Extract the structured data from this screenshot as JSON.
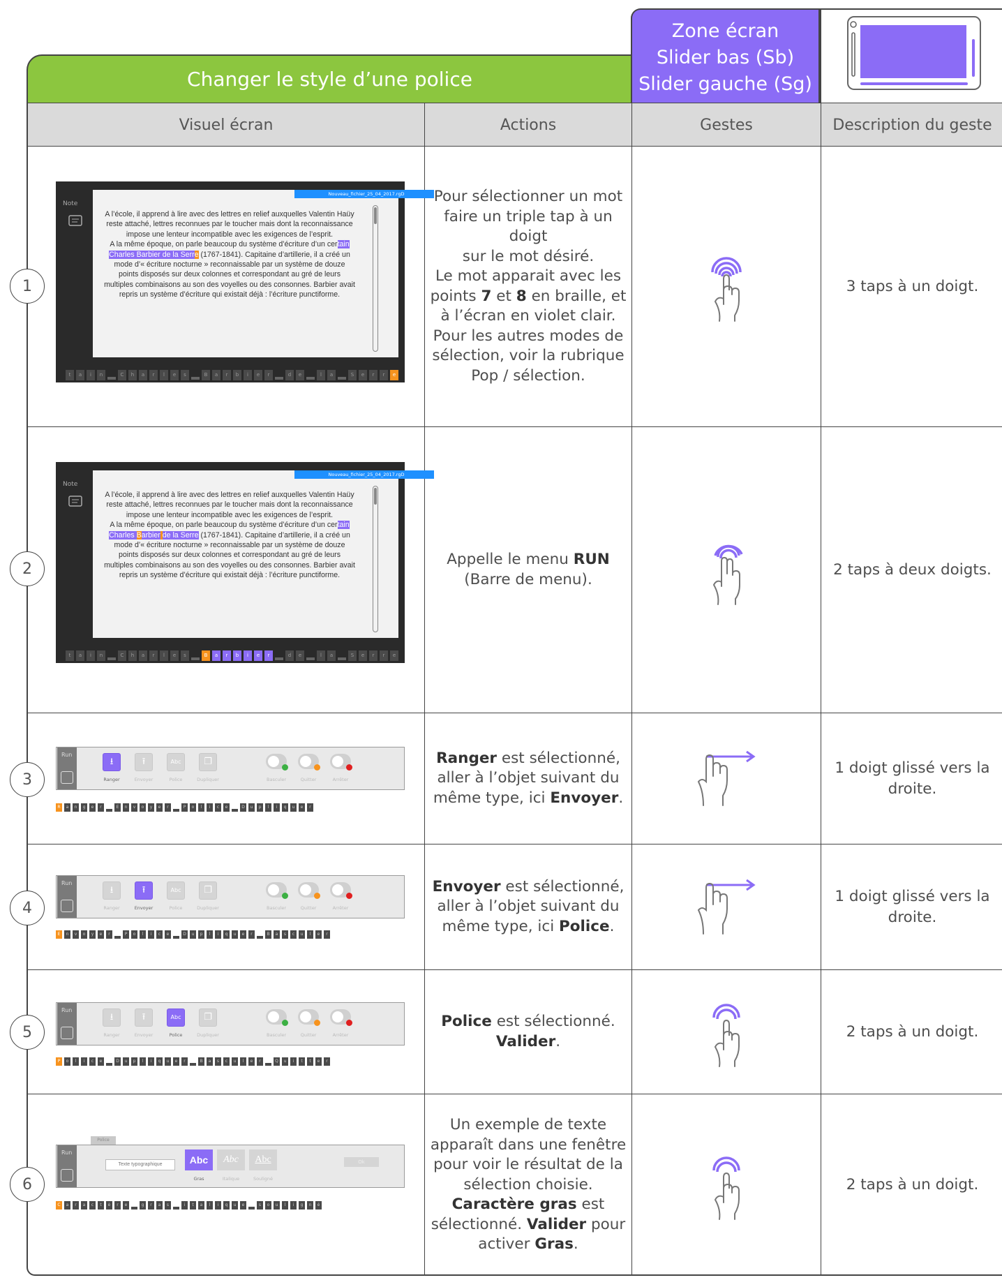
{
  "header": {
    "title": "Changer le style d’une police",
    "zone_lines": [
      "Zone écran",
      "Slider bas (Sb)",
      "Slider gauche (Sg)"
    ]
  },
  "columns": [
    "Visuel écran",
    "Actions",
    "Gestes",
    "Description du geste"
  ],
  "screen": {
    "note_label": "Note",
    "filename": "Nouveau_fichier_25_04_2017.rgD",
    "paragraph1": "A l’école, il apprend à lire avec des lettres en relief auxquelles Valentin Haüy reste attaché, lettres reconnues par le toucher mais dont la reconnaissance impose une lenteur incompatible avec les exigences de l’esprit.",
    "p2_pre": "A la même époque, on parle beaucoup du système d’écriture d’un cer",
    "p2_sel": "tain Charles Barbier de la Serre",
    "p2_post": " (1767-1841). Capitaine d’artillerie, il a créé un mode d’« écriture nocturne » reconnaissable par un système de douze points disposés sur deux colonnes et correspondant au gré de leurs multiples combinaisons au son des voyelles ou des consonnes. Barbier avait repris un système d’écriture qui existait déjà : l’écriture punctiforme."
  },
  "menu": {
    "run_label": "Run",
    "buttons": [
      "Ranger",
      "Envoyer",
      "Police",
      "Dupliquer"
    ],
    "toggles": [
      "Basculer",
      "Quitter",
      "Arrêter"
    ],
    "dialog_tab": "Police",
    "sample_text": "Texte typographique",
    "font_styles": [
      "Gras",
      "Italique",
      "Souligné"
    ],
    "font_glyph": "Abc",
    "ok_label": "Ok"
  },
  "rows": [
    {
      "num": "1",
      "action_html": "Pour sélectionner un mot faire un triple tap à un doigt<br>sur le mot désiré.<br>Le mot apparait avec les points <b>7</b> et <b>8</b> en braille, et à l’écran en violet clair.<br>Pour les autres modes de sélection, voir la rubrique<br>Pop / sélection.",
      "gesture": "triple-tap-icon",
      "desc": "3 taps à un doigt."
    },
    {
      "num": "2",
      "action_html": "Appelle le menu <b>RUN</b><br>(Barre de menu).",
      "gesture": "two-finger-tap-icon",
      "desc": "2 taps à deux doigts."
    },
    {
      "num": "3",
      "action_html": "<b>Ranger</b> est sélectionné, aller à l’objet suivant du même type, ici <b>Envoyer</b>.",
      "gesture": "swipe-right-icon",
      "desc": "1 doigt glissé vers la droite."
    },
    {
      "num": "4",
      "action_html": "<b>Envoyer</b> est sélectionné, aller à l’objet suivant du même type, ici <b>Police</b>.",
      "gesture": "swipe-right-icon",
      "desc": "1 doigt glissé vers la droite."
    },
    {
      "num": "5",
      "action_html": "<b>Police</b> est sélectionné.<br><b>Valider</b>.",
      "gesture": "double-tap-icon",
      "desc": "2 taps à un doigt."
    },
    {
      "num": "6",
      "action_html": "Un exemple de texte apparaît dans une fenêtre pour voir le résultat de la sélection choisie. <b>Caractère gras</b> est sélectionné. <b>Valider</b> pour activer <b>Gras</b>.",
      "gesture": "double-tap-icon",
      "desc": "2 taps à un doigt."
    }
  ],
  "braille": {
    "row1": "tain Charles Barbier de la Serre",
    "row2": "tain Charles Barbier de la Serre",
    "row3": "Ranger Envoyer Police Dupliquer",
    "row4": "Envoyer Police Dupliquer Basculer",
    "row5": "Police Dupliquer Basculer Quitter",
    "row6": "Caractère gras italique souligné"
  },
  "colors": {
    "green": "#8cc63f",
    "violet": "#8b6cf6",
    "orange": "#f7931e"
  }
}
